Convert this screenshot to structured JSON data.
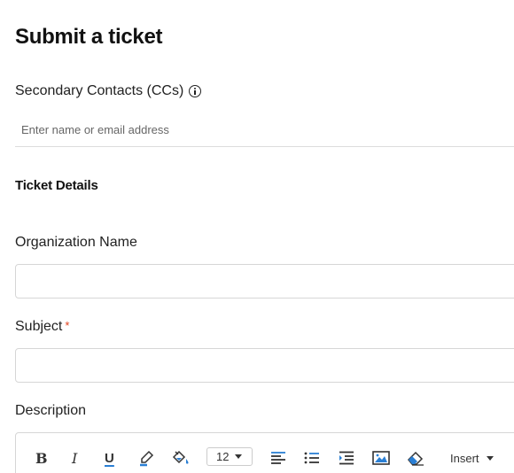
{
  "page": {
    "title": "Submit a ticket"
  },
  "cc": {
    "label": "Secondary Contacts (CCs)",
    "placeholder": "Enter name or email address",
    "value": ""
  },
  "details": {
    "title": "Ticket Details"
  },
  "organization": {
    "label": "Organization Name",
    "value": ""
  },
  "subject": {
    "label": "Subject",
    "required_mark": "*",
    "value": ""
  },
  "description": {
    "label": "Description"
  },
  "toolbar": {
    "bold": "B",
    "italic": "I",
    "underline": "U",
    "font_size": "12",
    "insert_label": "Insert"
  },
  "colors": {
    "accent": "#2a7fd4",
    "required": "#e2401c",
    "border": "#d6d6d6"
  }
}
